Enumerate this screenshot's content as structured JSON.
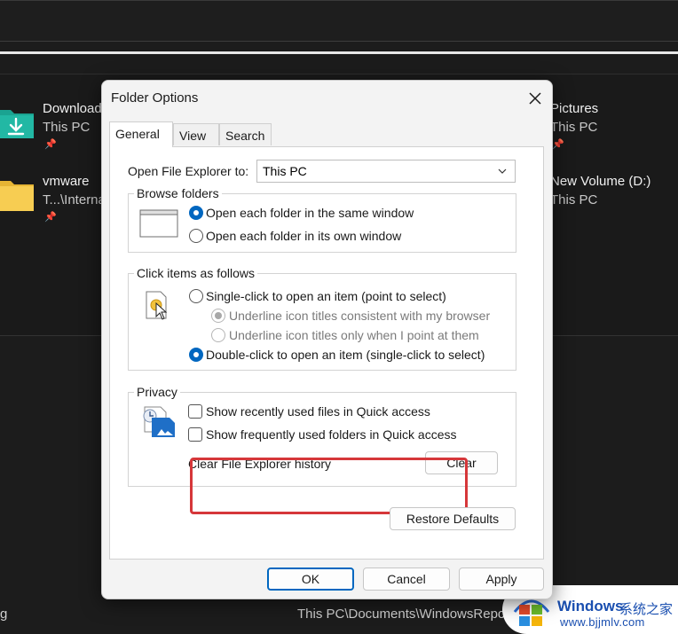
{
  "background": {
    "tiles": [
      {
        "name": "Downloads",
        "sub": "This PC",
        "pinned": true
      },
      {
        "name": "vmware",
        "sub": "T...\\Internal",
        "pinned": true
      },
      {
        "name": "Pictures",
        "sub": "This PC",
        "pinned": true
      },
      {
        "name": "New Volume (D:)",
        "sub": "This PC",
        "pinned": false
      }
    ],
    "bottom_left_text": "g",
    "bottom_path": "This PC\\Documents\\WindowsReport",
    "watermark": {
      "title": "Windows",
      "title2": "系统之家",
      "url": "www.bjjmlv.com"
    }
  },
  "dialog": {
    "title": "Folder Options",
    "tabs": [
      {
        "label": "General",
        "active": true
      },
      {
        "label": "View",
        "active": false
      },
      {
        "label": "Search",
        "active": false
      }
    ],
    "open_explorer": {
      "label": "Open File Explorer to:",
      "value": "This PC"
    },
    "browse_folders": {
      "title": "Browse folders",
      "options": [
        {
          "label": "Open each folder in the same window",
          "checked": true
        },
        {
          "label": "Open each folder in its own window",
          "checked": false
        }
      ]
    },
    "click_items": {
      "title": "Click items as follows",
      "single_click": {
        "label": "Single-click to open an item (point to select)",
        "checked": false
      },
      "sub_options": [
        {
          "label": "Underline icon titles consistent with my browser",
          "checked": true,
          "disabled": true
        },
        {
          "label": "Underline icon titles only when I point at them",
          "checked": false,
          "disabled": true
        }
      ],
      "double_click": {
        "label": "Double-click to open an item (single-click to select)",
        "checked": true
      }
    },
    "privacy": {
      "title": "Privacy",
      "checks": [
        {
          "label": "Show recently used files in Quick access",
          "checked": false
        },
        {
          "label": "Show frequently used folders in Quick access",
          "checked": false
        }
      ],
      "clear_label": "Clear File Explorer history",
      "clear_button": "Clear",
      "highlight_color": "#d6373a"
    },
    "restore_defaults": "Restore Defaults",
    "buttons": {
      "ok": "OK",
      "cancel": "Cancel",
      "apply": "Apply"
    },
    "accent_color": "#0067c0"
  }
}
